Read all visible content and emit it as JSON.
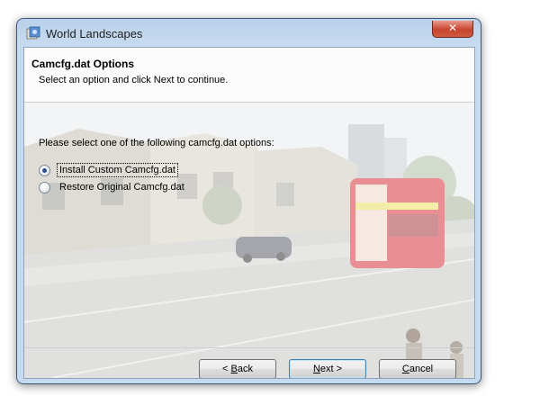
{
  "window": {
    "title": "World Landscapes",
    "close_glyph": "✕"
  },
  "header": {
    "title": "Camcfg.dat Options",
    "subtitle": "Select an option and click Next to continue."
  },
  "body": {
    "prompt": "Please select one of the following camcfg.dat options:",
    "options": [
      {
        "label": "Install Custom Camcfg.dat",
        "checked": true
      },
      {
        "label": "Restore Original Camcfg.dat",
        "checked": false
      }
    ]
  },
  "buttons": {
    "back": {
      "prefix": "< ",
      "mnemonic": "B",
      "rest": "ack"
    },
    "next": {
      "mnemonic": "N",
      "rest": "ext >"
    },
    "cancel": {
      "mnemonic": "C",
      "rest": "ancel"
    }
  },
  "icons": {
    "app": "installer-icon",
    "close": "close-icon"
  },
  "colors": {
    "frame": "#c7dbf0",
    "close_button": "#c6442f",
    "bus": "#d8323a",
    "default_button_border": "#3c7fb1"
  }
}
